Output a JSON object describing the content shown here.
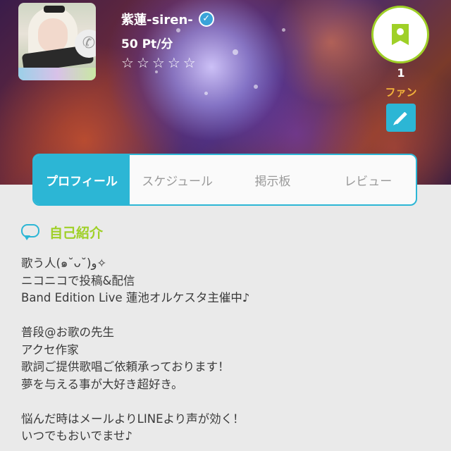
{
  "profile": {
    "name": "紫蓮-siren-",
    "price": "50 Pt/分",
    "rating_stars": 5,
    "rating_filled": 0,
    "star_glyph": "☆",
    "verified_glyph": "✓",
    "phone_glyph": "✆"
  },
  "fan": {
    "count": "1",
    "label": "ファン"
  },
  "tabs": [
    {
      "label": "プロフィール",
      "active": true
    },
    {
      "label": "スケジュール",
      "active": false
    },
    {
      "label": "掲示板",
      "active": false
    },
    {
      "label": "レビュー",
      "active": false
    }
  ],
  "section": {
    "title": "自己紹介"
  },
  "intro_lines": [
    "歌う人(๑˘ᴗ˘)و✧",
    "ニコニコで投稿&配信",
    "Band Edition Live 蓮池オルケスタ主催中♪",
    "",
    "普段@お歌の先生",
    "アクセ作家",
    "歌詞ご提供歌唱ご依頼承っております！",
    "夢を与える事が大好き超好き。",
    "",
    "悩んだ時はメールよりLINEより声が効く！",
    "いつでもおいでませ♪"
  ],
  "colors": {
    "accent_blue": "#2cb6d5",
    "accent_green": "#9fd027",
    "fan_orange": "#f3b23a"
  }
}
